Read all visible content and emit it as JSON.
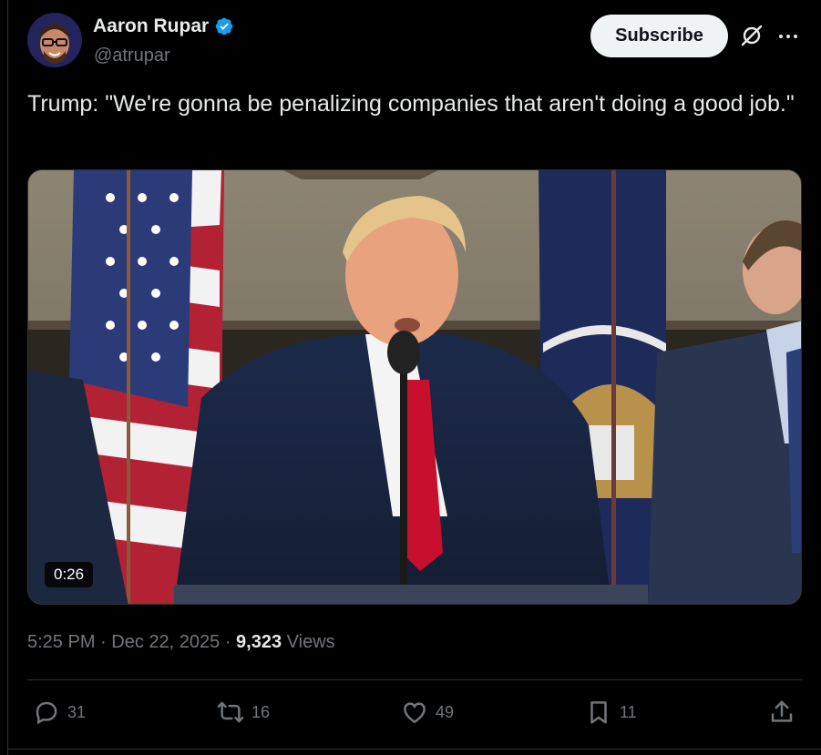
{
  "author": {
    "name": "Aaron Rupar",
    "handle": "@atrupar",
    "verified_color": "#1d9bf0"
  },
  "subscribe_label": "Subscribe",
  "tweet_text": "Trump: \"We're gonna be penalizing companies that aren't doing a good job.\"",
  "video": {
    "duration": "0:26"
  },
  "meta": {
    "time": "5:25 PM",
    "separator": " · ",
    "date": "Dec 22, 2025",
    "separator2": " · ",
    "views_count": "9,323",
    "views_label": " Views"
  },
  "actions": {
    "replies": "31",
    "reposts": "16",
    "likes": "49",
    "bookmarks": "11"
  },
  "icons": [
    "verified-icon",
    "grok-icon",
    "more-icon",
    "reply-icon",
    "repost-icon",
    "like-icon",
    "bookmark-icon",
    "share-icon"
  ],
  "colors": {
    "background": "#000000",
    "text": "#e7e9ea",
    "secondary": "#71767b",
    "border": "#2f3336"
  }
}
